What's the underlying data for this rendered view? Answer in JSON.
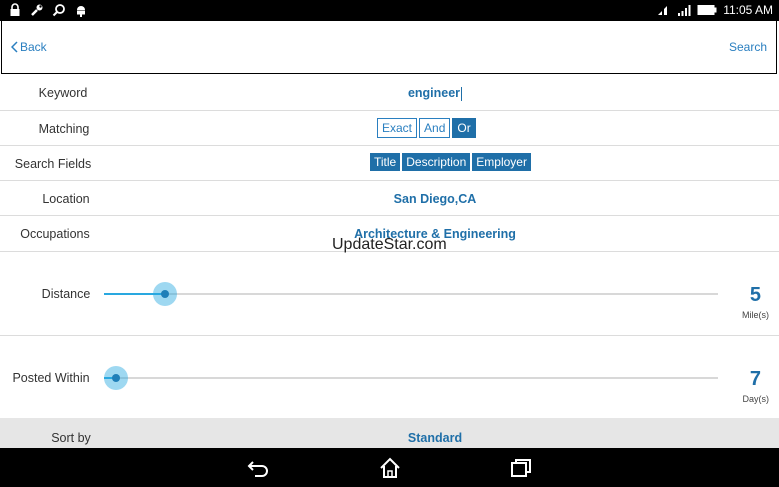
{
  "status_bar": {
    "left_icons": [
      "lock-icon",
      "wrench-icon",
      "search-icon",
      "android-icon"
    ],
    "right_icons": [
      "signal-icon",
      "wifi-icon",
      "battery-icon"
    ],
    "time": "11:05 AM"
  },
  "header": {
    "back_label": "Back",
    "search_label": "Search"
  },
  "form": {
    "keyword": {
      "label": "Keyword",
      "value": "engineer"
    },
    "matching": {
      "label": "Matching",
      "options": [
        "Exact",
        "And",
        "Or"
      ],
      "selected": "Or"
    },
    "search_fields": {
      "label": "Search Fields",
      "options": [
        "Title",
        "Description",
        "Employer"
      ]
    },
    "location": {
      "label": "Location",
      "value": "San Diego,CA"
    },
    "occupations": {
      "label": "Occupations",
      "value": "Architecture & Engineering"
    },
    "distance": {
      "label": "Distance",
      "value": "5",
      "unit": "Mile(s)",
      "slider_fraction": 0.1
    },
    "posted_within": {
      "label": "Posted Within",
      "value": "7",
      "unit": "Day(s)",
      "slider_fraction": 0.02
    },
    "sort_by": {
      "label": "Sort by",
      "value": "Standard"
    }
  },
  "watermark": "UpdateStar.com",
  "nav_bar": {
    "buttons": [
      "back-nav-icon",
      "home-icon",
      "recent-apps-icon"
    ]
  },
  "colors": {
    "accent": "#1f6fa8",
    "slider": "#29a8e0"
  }
}
